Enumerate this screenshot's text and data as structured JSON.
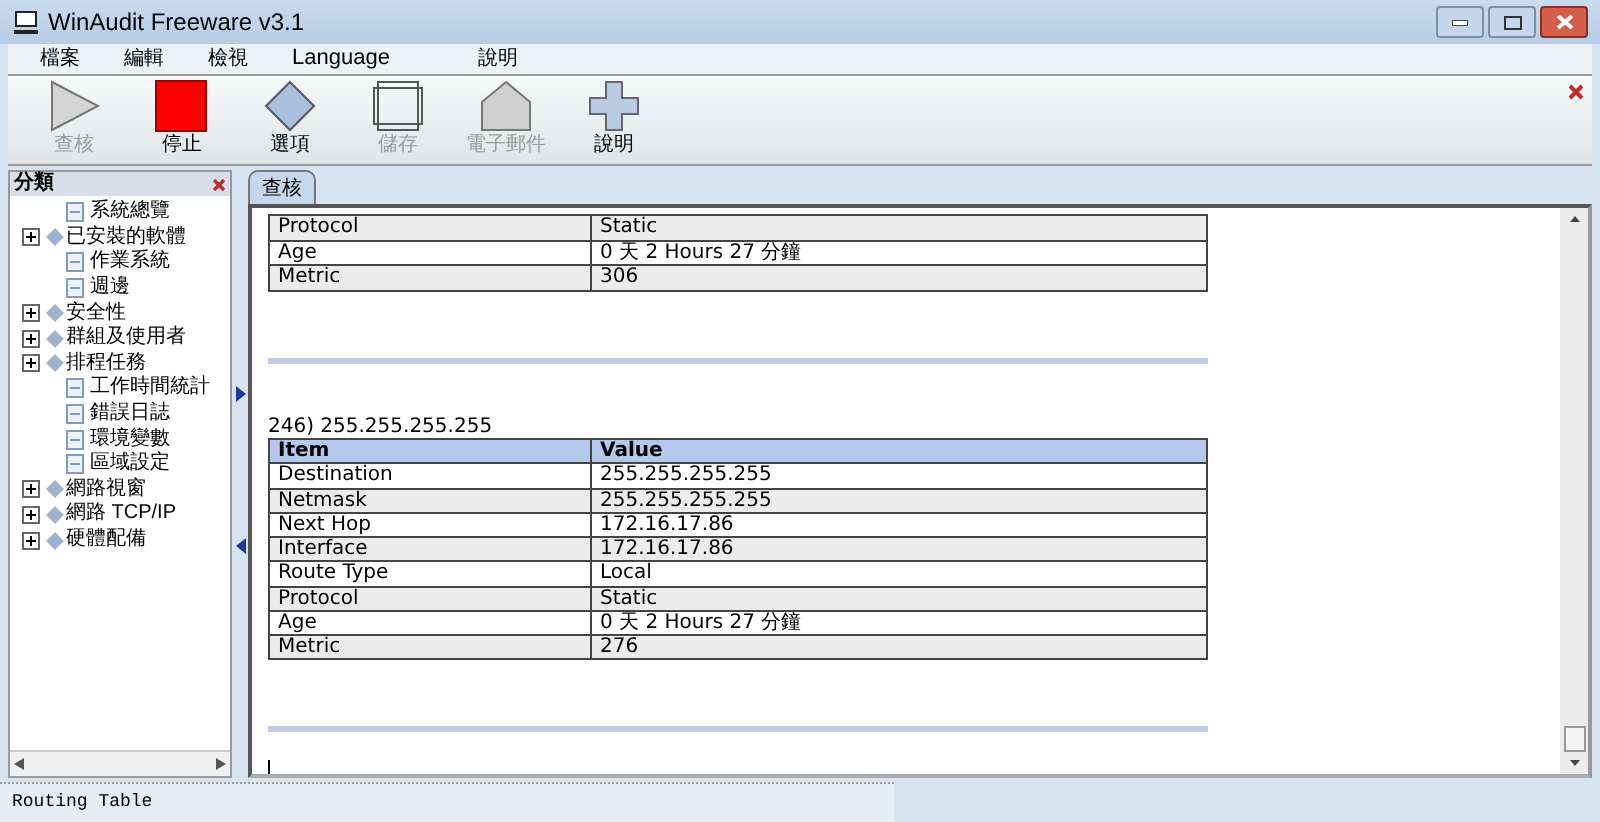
{
  "window": {
    "title": "WinAudit Freeware v3.1"
  },
  "menu": [
    "檔案",
    "編輯",
    "檢視",
    "Language",
    "說明"
  ],
  "toolbar": [
    {
      "label": "查核",
      "kind": "play",
      "disabled": true
    },
    {
      "label": "停止",
      "kind": "stop",
      "disabled": false
    },
    {
      "label": "選項",
      "kind": "diamond",
      "disabled": false
    },
    {
      "label": "儲存",
      "kind": "squares",
      "disabled": true
    },
    {
      "label": "電子郵件",
      "kind": "house",
      "disabled": true
    },
    {
      "label": "說明",
      "kind": "plus",
      "disabled": false
    }
  ],
  "sidebar": {
    "title": "分類",
    "items": [
      {
        "label": "系統總覽",
        "kind": "leaf"
      },
      {
        "label": "已安裝的軟體",
        "kind": "folder",
        "expanded": false
      },
      {
        "label": "作業系統",
        "kind": "leaf"
      },
      {
        "label": "週邊",
        "kind": "leaf"
      },
      {
        "label": "安全性",
        "kind": "folder",
        "expanded": false
      },
      {
        "label": "群組及使用者",
        "kind": "folder",
        "expanded": false
      },
      {
        "label": "排程任務",
        "kind": "folder",
        "expanded": false
      },
      {
        "label": "工作時間統計",
        "kind": "leaf"
      },
      {
        "label": "錯誤日誌",
        "kind": "leaf"
      },
      {
        "label": "環境變數",
        "kind": "leaf"
      },
      {
        "label": "區域設定",
        "kind": "leaf"
      },
      {
        "label": "網路視窗",
        "kind": "folder",
        "expanded": false
      },
      {
        "label": "網路 TCP/IP",
        "kind": "folder",
        "expanded": false
      },
      {
        "label": "硬體配備",
        "kind": "folder",
        "expanded": false
      }
    ]
  },
  "tabs": [
    {
      "label": "查核",
      "selected": true
    }
  ],
  "sections": [
    {
      "rows": [
        {
          "item": "Protocol",
          "value": "Static",
          "shaded": true
        },
        {
          "item": "Age",
          "value": "0 天 2 Hours 27 分鐘",
          "shaded": false
        },
        {
          "item": "Metric",
          "value": "306",
          "shaded": true
        }
      ]
    },
    {
      "title": "246) 255.255.255.255",
      "columns": [
        "Item",
        "Value"
      ],
      "rows": [
        {
          "item": "Destination",
          "value": "255.255.255.255",
          "shaded": false
        },
        {
          "item": "Netmask",
          "value": "255.255.255.255",
          "shaded": true
        },
        {
          "item": "Next Hop",
          "value": "172.16.17.86",
          "shaded": false
        },
        {
          "item": "Interface",
          "value": "172.16.17.86",
          "shaded": true
        },
        {
          "item": "Route Type",
          "value": "Local",
          "shaded": false
        },
        {
          "item": "Protocol",
          "value": "Static",
          "shaded": true
        },
        {
          "item": "Age",
          "value": "0 天 2 Hours 27 分鐘",
          "shaded": false
        },
        {
          "item": "Metric",
          "value": "276",
          "shaded": true
        }
      ]
    }
  ],
  "status_bar": "Routing Table"
}
